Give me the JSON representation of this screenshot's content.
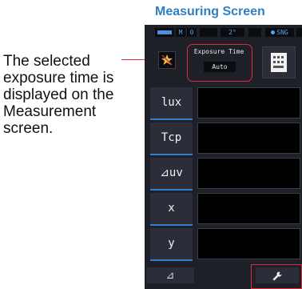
{
  "title": "Measuring Screen",
  "description": "The selected exposure time is displayed on the Measurement screen.",
  "status_bar": {
    "mode": "M",
    "mode_value": "0",
    "angle": "2°",
    "sng": "SNG"
  },
  "exposure": {
    "label": "Exposure Time",
    "value": "Auto"
  },
  "rows": [
    {
      "label": "lux"
    },
    {
      "label": "Tcp"
    },
    {
      "label": "⊿uv"
    },
    {
      "label": "x"
    },
    {
      "label": "y"
    }
  ],
  "bottom": {
    "delta_label": "⊿"
  },
  "colors": {
    "title": "#2e7fc4",
    "highlight": "#e0293a",
    "accent": "#2d7fd0",
    "device_bg": "#1e2028"
  },
  "icons": [
    "star-warning-icon",
    "memory-card-icon",
    "wrench-icon",
    "battery-icon"
  ]
}
